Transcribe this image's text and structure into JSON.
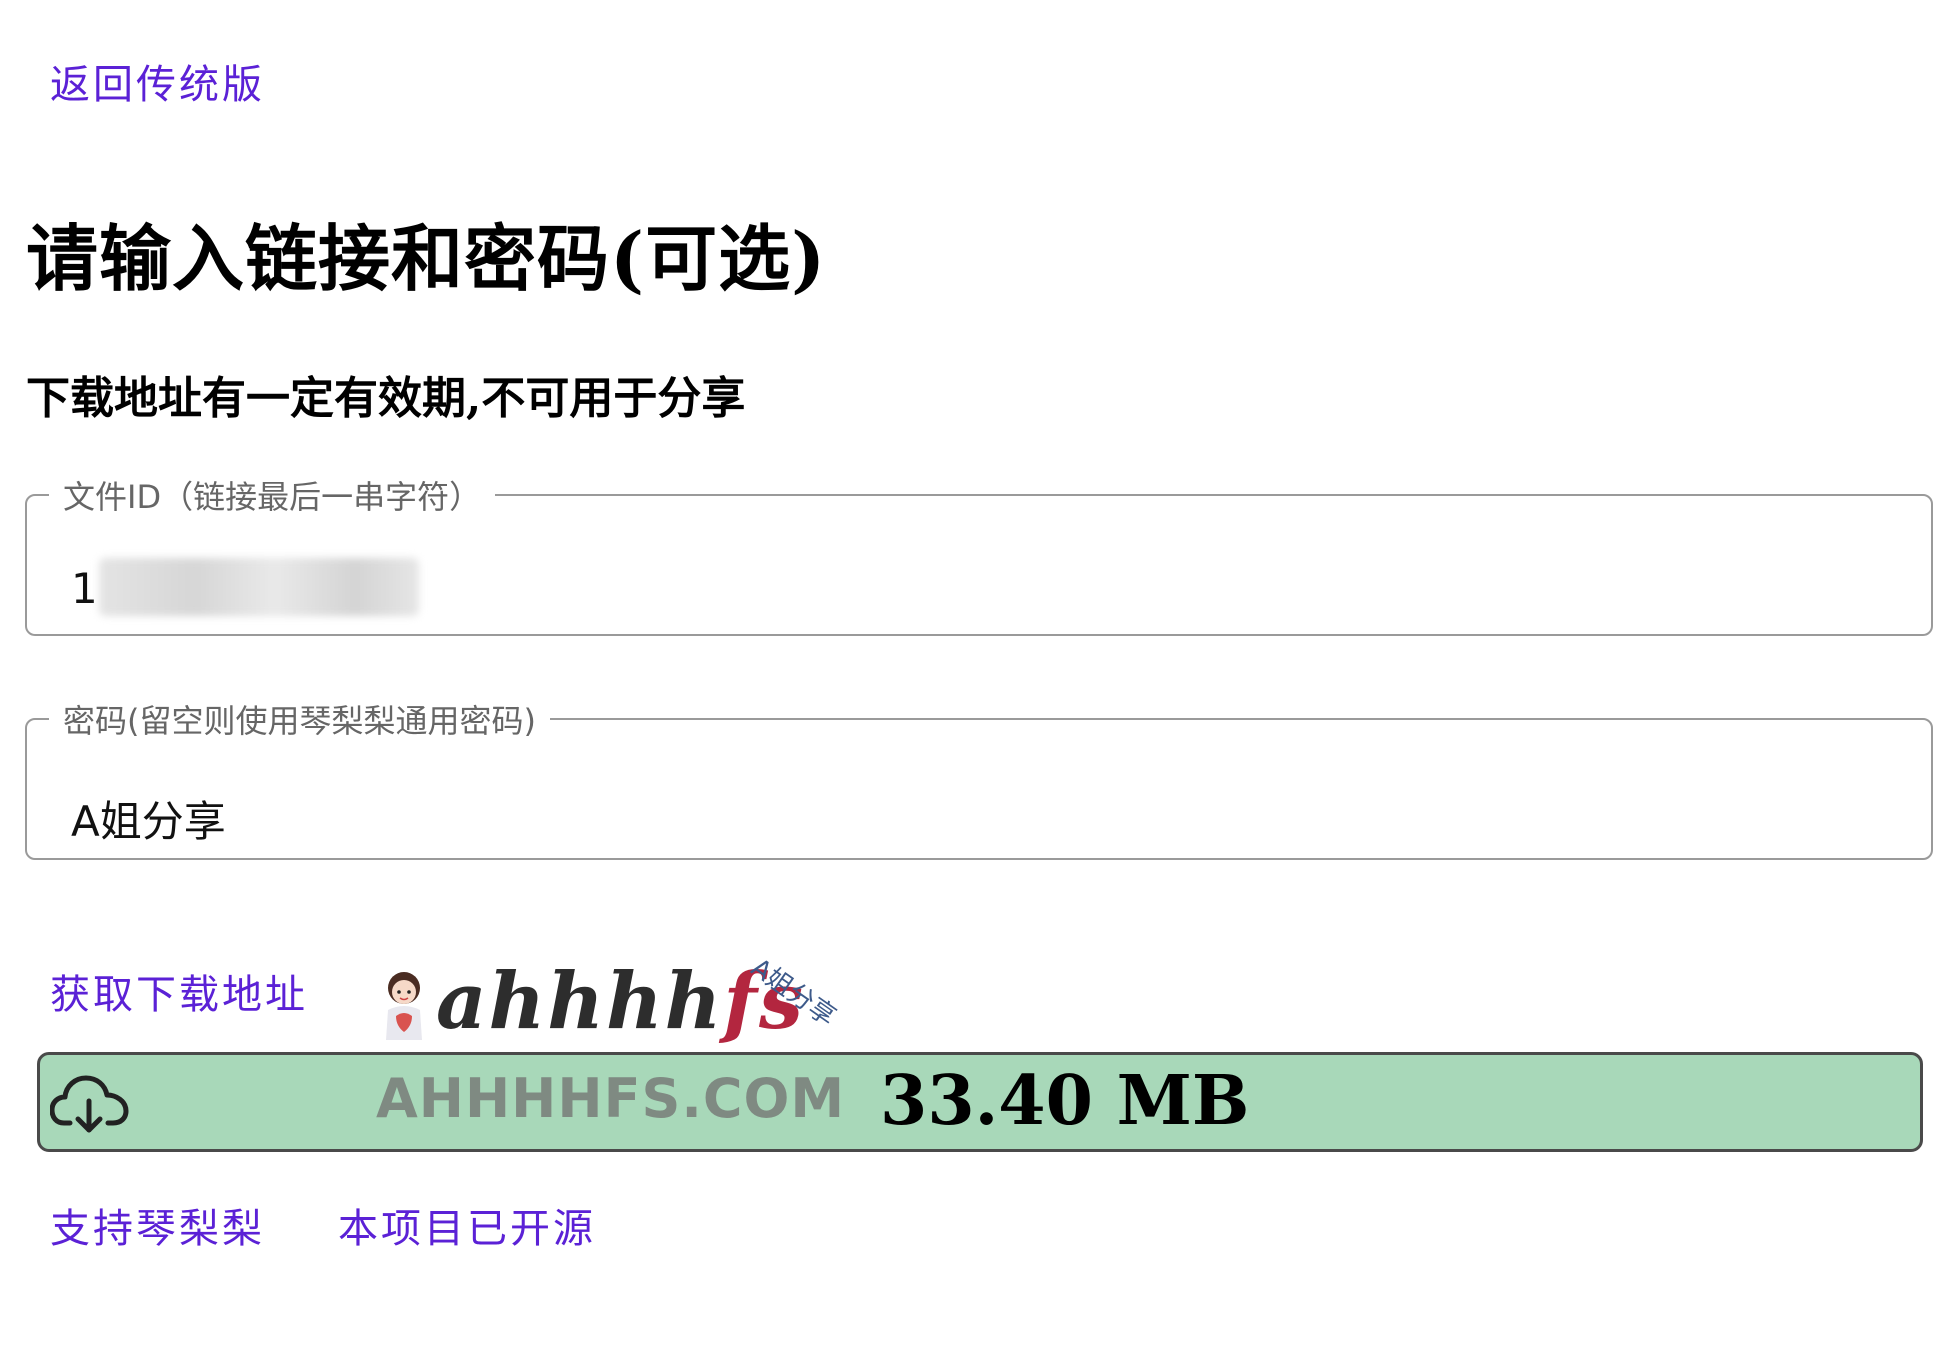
{
  "nav": {
    "back_link": "返回传统版"
  },
  "heading": "请输入链接和密码(可选)",
  "subheading": "下载地址有一定有效期,不可用于分享",
  "file_id_field": {
    "legend": "文件ID（链接最后一串字符）",
    "value_prefix": "1",
    "value_suffix": "38"
  },
  "password_field": {
    "legend": "密码(留空则使用琴梨梨通用密码)",
    "value": "A姐分享"
  },
  "get_link": "获取下载地址",
  "watermark": {
    "script_main": "ahhhh",
    "script_accent": "fs",
    "tag": "A姐分享",
    "domain": "AHHHHFS.COM"
  },
  "download": {
    "size": "33.40 MB",
    "icon": "cloud-download-icon",
    "bar_color": "#a8d8b9"
  },
  "footer": {
    "support_link": "支持琴梨梨",
    "opensource_link": "本项目已开源"
  },
  "colors": {
    "link": "#5b21d6"
  }
}
